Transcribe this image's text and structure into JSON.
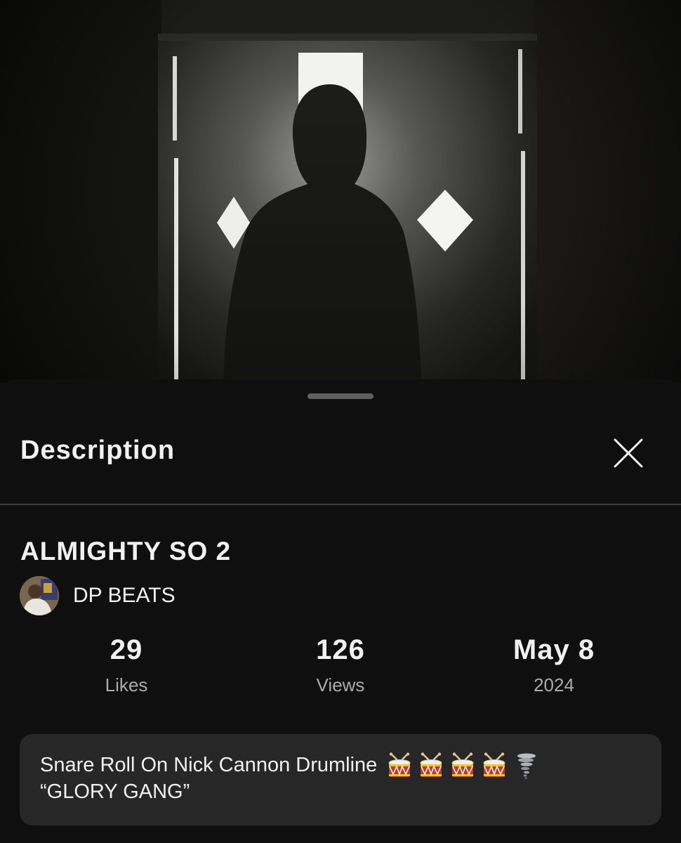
{
  "sheet": {
    "title": "Description",
    "close_icon": "close-icon"
  },
  "video": {
    "title": "ALMIGHTY SO 2",
    "channel_name": "DP BEATS"
  },
  "stats": {
    "likes_value": "29",
    "likes_label": "Likes",
    "views_value": "126",
    "views_label": "Views",
    "date_value": "May 8",
    "date_label": "2024"
  },
  "description": {
    "line1": "Snare Roll On Nick Cannon Drumline",
    "emojis": [
      "drum-icon",
      "drum-icon",
      "drum-icon",
      "drum-icon",
      "tornado-icon"
    ],
    "line2": "“GLORY GANG”"
  },
  "colors": {
    "background": "#0f0f0f",
    "text": "#f1f1f1",
    "secondary_text": "#aaaaaa",
    "description_box": "#272727",
    "divider": "#3d3d3d"
  }
}
